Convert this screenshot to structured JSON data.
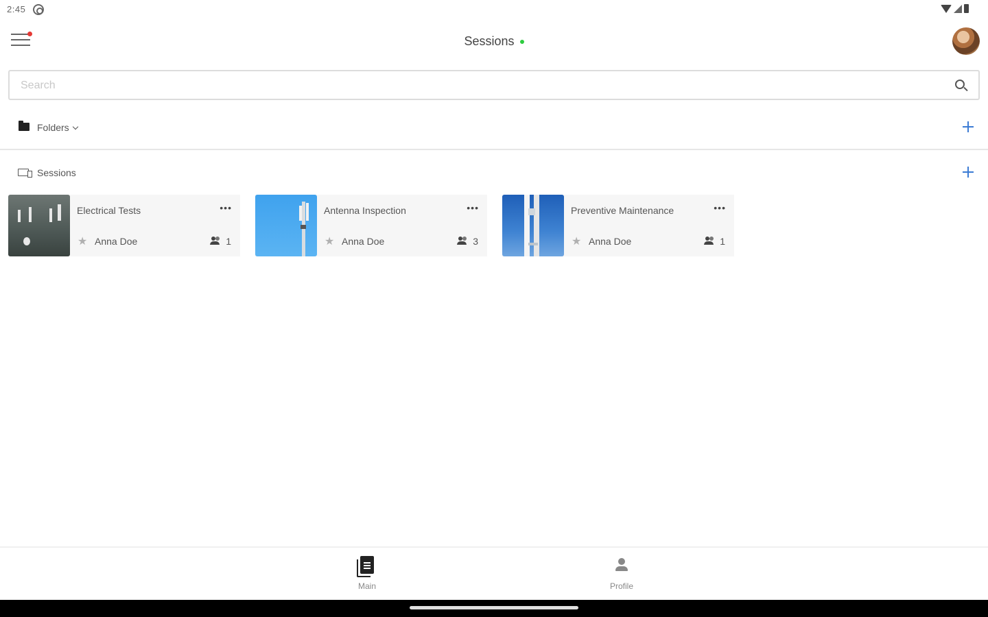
{
  "status_bar": {
    "time": "2:45"
  },
  "app_bar": {
    "title": "Sessions"
  },
  "search": {
    "placeholder": "Search",
    "value": ""
  },
  "folders": {
    "label": "Folders"
  },
  "sessions": {
    "label": "Sessions",
    "items": [
      {
        "title": "Electrical Tests",
        "owner": "Anna Doe",
        "members": "1"
      },
      {
        "title": "Antenna Inspection",
        "owner": "Anna Doe",
        "members": "3"
      },
      {
        "title": "Preventive Maintenance",
        "owner": "Anna Doe",
        "members": "1"
      }
    ]
  },
  "bottom_nav": {
    "items": [
      {
        "label": "Main",
        "icon": "document-icon",
        "active": true
      },
      {
        "label": "Profile",
        "icon": "person-icon",
        "active": false
      }
    ]
  },
  "colors": {
    "accent": "#3b7bd4",
    "online": "#2ecc40",
    "notification": "#e53935"
  },
  "icons": {
    "more": "•••",
    "star": "★"
  }
}
